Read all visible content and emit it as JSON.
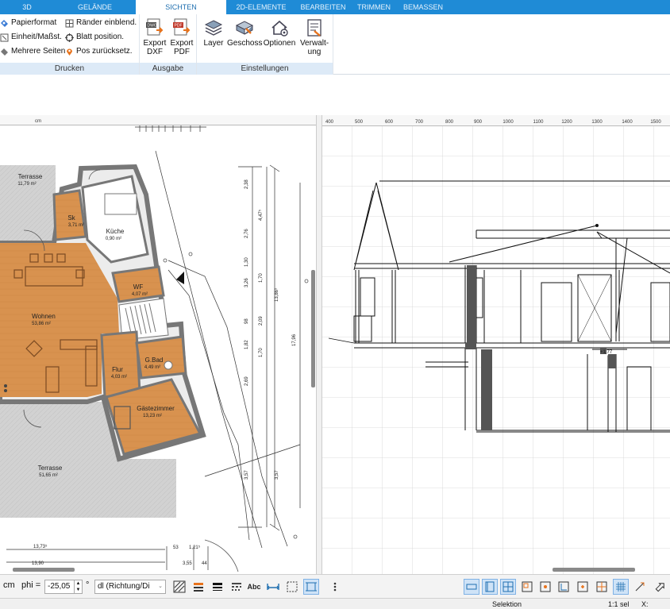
{
  "tabs": [
    {
      "label": "3D"
    },
    {
      "label": "GELÄNDE"
    },
    {
      "label": "SICHTEN"
    },
    {
      "label": "2D-ELEMENTE"
    },
    {
      "label": "BEARBEITEN"
    },
    {
      "label": "TRIMMEN"
    },
    {
      "label": "BEMASSEN"
    }
  ],
  "ribbon": {
    "drucken": {
      "title": "Drucken",
      "papierformat": "Papierformat",
      "einheit": "Einheit/Maßst.",
      "mehrere_seiten": "Mehrere Seiten",
      "raender": "Ränder einblend.",
      "blatt_position": "Blatt position.",
      "pos_zurueck": "Pos zurücksetz."
    },
    "ausgabe": {
      "title": "Ausgabe",
      "export_dxf": [
        "Export",
        "DXF"
      ],
      "export_pdf": [
        "Export",
        "PDF"
      ]
    },
    "einstellungen": {
      "title": "Einstellungen",
      "layer": "Layer",
      "geschoss": "Geschoss",
      "optionen": "Optionen",
      "verwaltung": [
        "Verwalt-",
        "ung"
      ]
    }
  },
  "plan": {
    "ruler_unit": "cm",
    "rooms": [
      {
        "name": "Terrasse",
        "area": "11,79 m²"
      },
      {
        "name": "Sk",
        "area": "3,71 m²"
      },
      {
        "name": "Küche",
        "area": "0,90 m²"
      },
      {
        "name": "WF",
        "area": "4,07 m²"
      },
      {
        "name": "Wohnen",
        "area": "53,86 m²"
      },
      {
        "name": "G.Bad",
        "area": "4,49 m²"
      },
      {
        "name": "Flur",
        "area": "4,03 m²"
      },
      {
        "name": "Gästezimmer",
        "area": "13,23 m²"
      },
      {
        "name": "Terrasse",
        "area": "51,65 m²"
      }
    ],
    "dims_vertical": [
      "2,38",
      "4,47⁵",
      "2,76",
      "1,70",
      "2,09",
      "1,70",
      "2,69",
      "3,57",
      "3,57",
      "13,86⁵",
      "17,96",
      "3,26",
      "1,30",
      "98",
      "1,82"
    ],
    "dims_bottom": [
      "13,73⁵",
      "13,90",
      "53",
      "1,21⁵",
      "3,55",
      "44"
    ]
  },
  "section": {
    "ruler_labels": [
      "400",
      "500",
      "600",
      "700",
      "800",
      "900",
      "1000",
      "1100",
      "1200",
      "1300",
      "1400",
      "1500"
    ],
    "level_mark": "+1,77"
  },
  "bottombar": {
    "unit": "cm",
    "phi_label": "phi =",
    "phi_value": "-25,05",
    "degree": "°",
    "dl_value": "dl (Richtung/Di"
  },
  "status": {
    "mode": "Selektion",
    "scale": "1:1 sel",
    "x_label": "X:"
  },
  "colors": {
    "accent": "#1f8bd6",
    "floor": "#d8924f",
    "wall": "#777777",
    "ribbon_footer": "#ddeaf7"
  }
}
